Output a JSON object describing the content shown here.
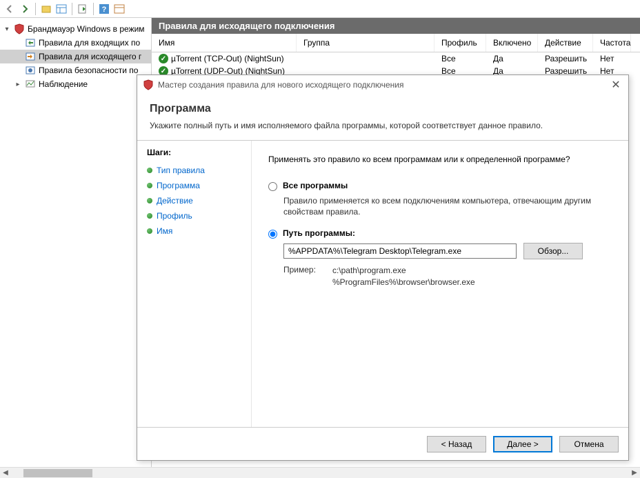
{
  "toolbar": {},
  "tree": {
    "root": "Брандмауэр Windows в режим",
    "items": [
      "Правила для входящих по",
      "Правила для исходящего г",
      "Правила безопасности по",
      "Наблюдение"
    ]
  },
  "panel": {
    "header": "Правила для исходящего подключения",
    "columns": {
      "name": "Имя",
      "group": "Группа",
      "profile": "Профиль",
      "enabled": "Включено",
      "action": "Действие",
      "rate": "Частота"
    },
    "rows": [
      {
        "name": "µTorrent (TCP-Out) (NightSun)",
        "group": "",
        "profile": "Все",
        "enabled": "Да",
        "action": "Разрешить",
        "rate": "Нет"
      },
      {
        "name": "µTorrent (UDP-Out) (NightSun)",
        "group": "",
        "profile": "Все",
        "enabled": "Да",
        "action": "Разрешить",
        "rate": "Нет"
      }
    ]
  },
  "wizard": {
    "title": "Мастер создания правила для нового исходящего подключения",
    "header_title": "Программа",
    "header_desc": "Укажите полный путь и имя исполняемого файла программы, которой соответствует данное правило.",
    "steps_title": "Шаги:",
    "steps": [
      "Тип правила",
      "Программа",
      "Действие",
      "Профиль",
      "Имя"
    ],
    "question": "Применять это правило ко всем программам или к определенной программе?",
    "opt_all_label": "Все программы",
    "opt_all_desc": "Правило применяется ко всем подключениям компьютера, отвечающим другим свойствам правила.",
    "opt_path_label": "Путь программы:",
    "path_value": "%APPDATA%\\Telegram Desktop\\Telegram.exe",
    "browse": "Обзор...",
    "example_label": "Пример:",
    "example1": "c:\\path\\program.exe",
    "example2": "%ProgramFiles%\\browser\\browser.exe",
    "btn_back": "< Назад",
    "btn_next": "Далее >",
    "btn_cancel": "Отмена"
  }
}
